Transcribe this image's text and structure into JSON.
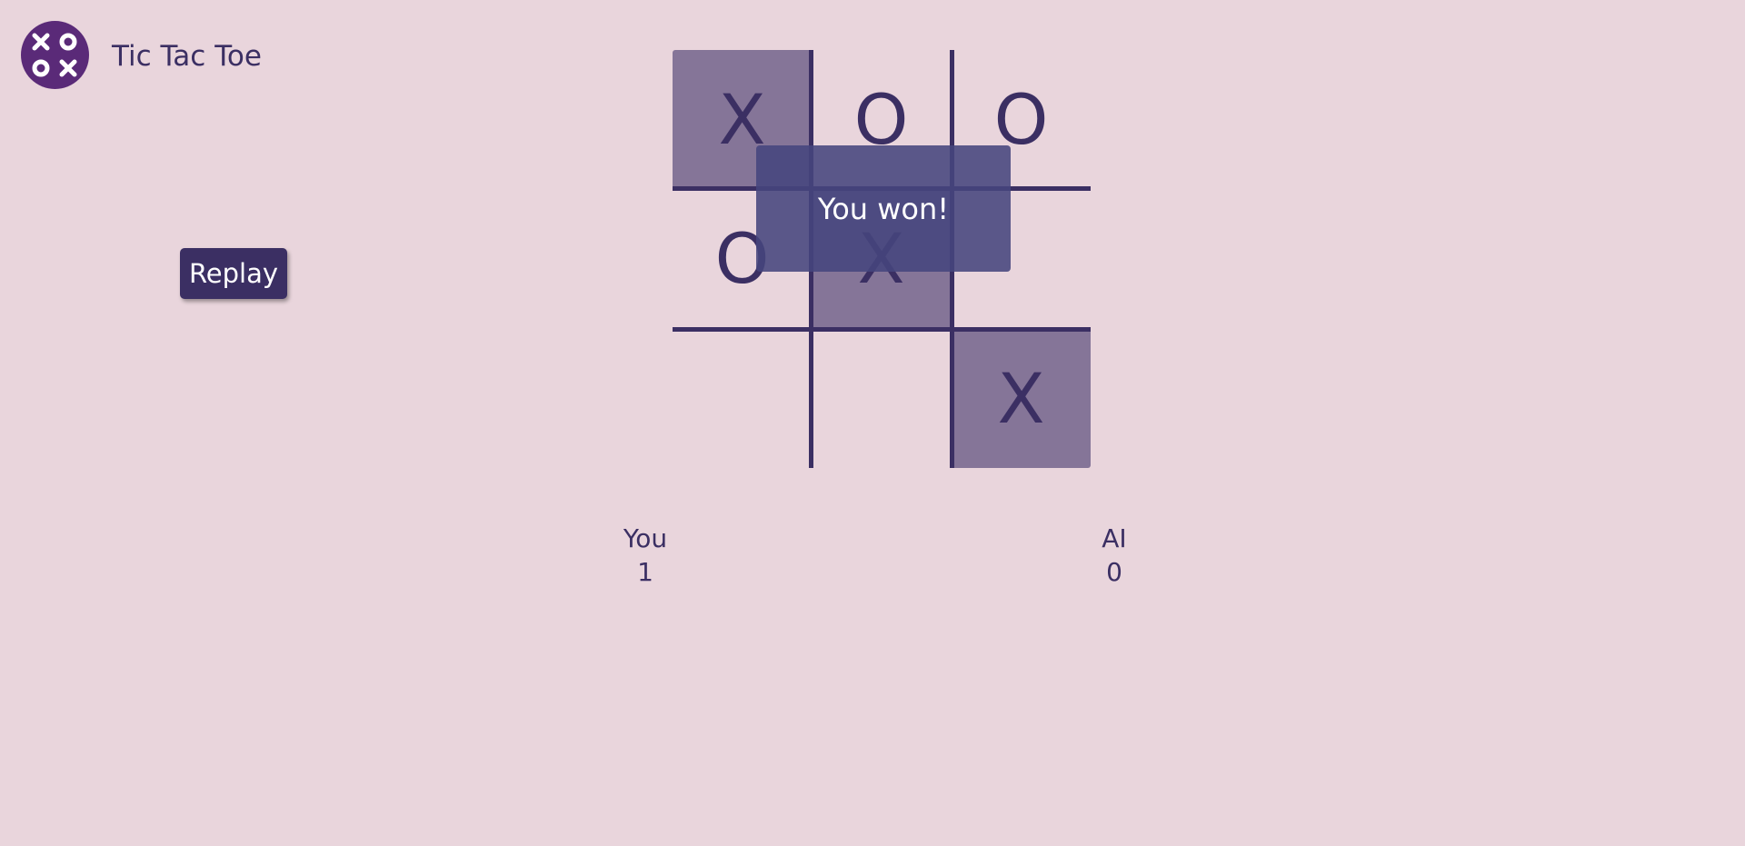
{
  "app": {
    "title": "Tic Tac Toe",
    "logo_icon": "xoox-logo-icon"
  },
  "controls": {
    "replay_label": "Replay"
  },
  "board": {
    "cells": [
      "X",
      "O",
      "O",
      "O",
      "X",
      "",
      "",
      "",
      "X"
    ],
    "winning_cells": [
      0,
      4,
      8
    ]
  },
  "result": {
    "message": "You won!"
  },
  "scores": {
    "you_label": "You",
    "you_score": "1",
    "ai_label": "AI",
    "ai_score": "0"
  },
  "colors": {
    "background": "#e9d5dc",
    "ink": "#3b2f63",
    "winning_cell": "#857598",
    "overlay": "#46467d",
    "logo": "#5a2a78"
  }
}
